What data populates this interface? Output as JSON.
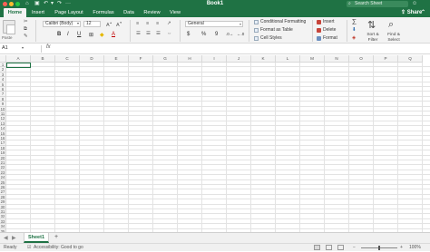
{
  "window": {
    "title": "Book1",
    "search_placeholder": "Search Sheet",
    "titlebar_icons": [
      "save-icon",
      "undo-icon",
      "redo-icon",
      "more-icon"
    ]
  },
  "tabs": [
    {
      "label": "Home",
      "active": true
    },
    {
      "label": "Insert",
      "active": false
    },
    {
      "label": "Page Layout",
      "active": false
    },
    {
      "label": "Formulas",
      "active": false
    },
    {
      "label": "Data",
      "active": false
    },
    {
      "label": "Review",
      "active": false
    },
    {
      "label": "View",
      "active": false
    }
  ],
  "share_label": "Share",
  "ribbon": {
    "paste_label": "Paste",
    "font_name": "Calibri (Body)",
    "font_size": "12",
    "bold": "B",
    "italic": "I",
    "underline": "U",
    "number_format": "General",
    "currency": "$",
    "percent": "%",
    "comma": "9",
    "styles": [
      "Conditional Formatting",
      "Format as Table",
      "Cell Styles"
    ],
    "cells": [
      "Insert",
      "Delete",
      "Format"
    ],
    "sort_filter": "Sort & Filter",
    "find_select": "Find & Select"
  },
  "formula_bar": {
    "name_box": "A1",
    "fx": "fx",
    "value": ""
  },
  "grid": {
    "columns": [
      "A",
      "B",
      "C",
      "D",
      "E",
      "F",
      "G",
      "H",
      "I",
      "J",
      "K",
      "L",
      "M",
      "N",
      "O",
      "P",
      "Q"
    ],
    "rows": [
      "1",
      "2",
      "3",
      "4",
      "5",
      "6",
      "7",
      "8",
      "9",
      "10",
      "11",
      "12",
      "13",
      "14",
      "15",
      "16",
      "17",
      "18",
      "19",
      "20",
      "21",
      "22",
      "23",
      "24",
      "25",
      "26",
      "27",
      "28",
      "29",
      "30",
      "31",
      "32",
      "33",
      "34",
      "35",
      "36"
    ],
    "selected_cell": "A1"
  },
  "sheets": [
    {
      "name": "Sheet1",
      "active": true
    }
  ],
  "add_sheet": "+",
  "status": {
    "ready": "Ready",
    "accessibility": "Accessibility: Good to go",
    "zoom": "100%"
  },
  "colors": {
    "brand_green": "#1f7244",
    "ribbon_bg": "#f3f3f3"
  }
}
